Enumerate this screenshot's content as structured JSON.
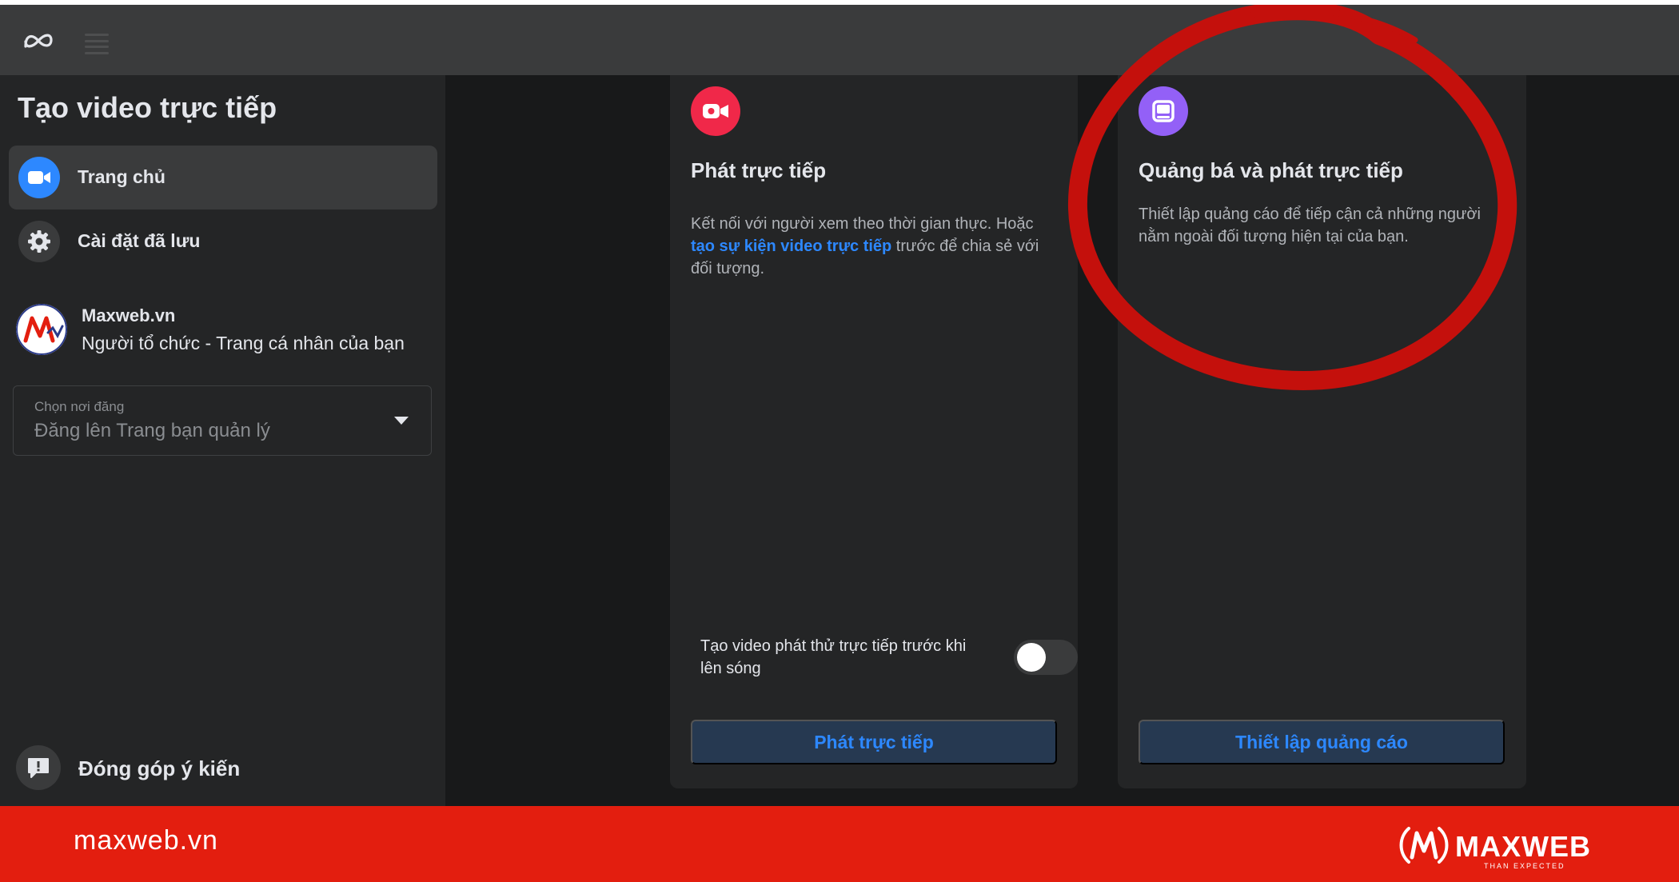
{
  "topbar": {
    "logo_icon": "meta-logo-icon",
    "menu_icon": "menu-icon"
  },
  "sidebar": {
    "title": "Tạo video trực tiếp",
    "items": [
      {
        "label": "Trang chủ",
        "icon": "video-camera-icon",
        "active": true
      },
      {
        "label": "Cài đặt đã lưu",
        "icon": "gear-icon",
        "active": false
      }
    ],
    "profile": {
      "name": "Maxweb.vn",
      "subtitle": "Người tổ chức - Trang cá nhân của bạn"
    },
    "post_select": {
      "label": "Chọn nơi đăng",
      "value": "Đăng lên Trang bạn quản lý"
    },
    "feedback": {
      "label": "Đóng góp ý kiến",
      "icon": "feedback-icon"
    }
  },
  "cards": [
    {
      "title": "Phát trực tiếp",
      "icon": "video-camera-icon",
      "desc_prefix": "Kết nối với người xem theo thời gian thực. Hoặc ",
      "desc_link": "tạo sự kiện video trực tiếp",
      "desc_suffix": " trước để chia sẻ với đối tượng.",
      "toggle_label": "Tạo video phát thử trực tiếp trước khi lên sóng",
      "toggle_on": false,
      "button": "Phát trực tiếp"
    },
    {
      "title": "Quảng bá và phát trực tiếp",
      "icon": "ad-screen-icon",
      "desc": "Thiết lập quảng cáo để tiếp cận cả những người nằm ngoài đối tượng hiện tại của bạn.",
      "button": "Thiết lập quảng cáo"
    }
  ],
  "colors": {
    "accent_blue": "#2d88ff",
    "live_red": "#f02849",
    "promo_purple": "#9360f7",
    "annotation_red": "#c4100c",
    "footer_red": "#e31e0f"
  },
  "footer": {
    "url": "maxweb.vn",
    "brand_name": "MAXWEB",
    "brand_tagline": "THAN EXPECTED"
  }
}
